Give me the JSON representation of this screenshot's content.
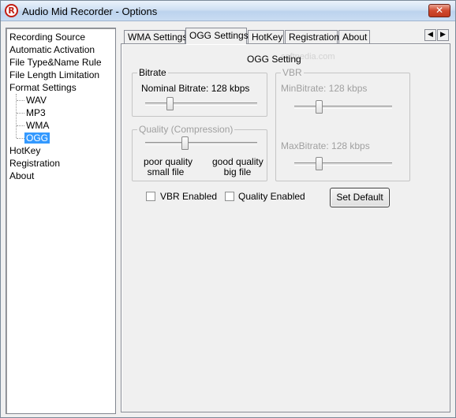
{
  "window": {
    "title": "Audio Mid Recorder - Options",
    "close_glyph": "✕",
    "icon_letter": "R"
  },
  "tree": {
    "items": [
      {
        "label": "Recording Source"
      },
      {
        "label": "Automatic Activation"
      },
      {
        "label": "File Type&Name Rule"
      },
      {
        "label": "File Length Limitation"
      },
      {
        "label": "Format Settings"
      },
      {
        "label": "WAV"
      },
      {
        "label": "MP3"
      },
      {
        "label": "WMA"
      },
      {
        "label": "OGG"
      },
      {
        "label": "HotKey"
      },
      {
        "label": "Registration"
      },
      {
        "label": "About"
      }
    ],
    "selected": "OGG"
  },
  "tabs": {
    "items": [
      {
        "label": "WMA Settings"
      },
      {
        "label": "OGG Settings"
      },
      {
        "label": "HotKey"
      },
      {
        "label": "Registration"
      },
      {
        "label": "About"
      }
    ],
    "active": "OGG Settings",
    "scroll_left": "◀",
    "scroll_right": "▶"
  },
  "panel": {
    "heading": "OGG Setting",
    "watermark": "softpedia.com",
    "bitrate": {
      "legend": "Bitrate",
      "nominal_label": "Nominal Bitrate: 128 kbps",
      "nominal_level": 0.22
    },
    "quality": {
      "legend": "Quality (Compression)",
      "level": 0.35,
      "left_line1": "poor quality",
      "left_line2": "small file",
      "right_line1": "good quality",
      "right_line2": "big file"
    },
    "vbr": {
      "legend": "VBR",
      "min_label": "MinBitrate: 128 kbps",
      "min_level": 0.25,
      "max_label": "MaxBitrate: 128 kbps",
      "max_level": 0.25
    },
    "vbr_enabled": {
      "label": "VBR Enabled",
      "checked": false
    },
    "quality_enabled": {
      "label": "Quality Enabled",
      "checked": false
    },
    "set_default_label": "Set Default"
  }
}
